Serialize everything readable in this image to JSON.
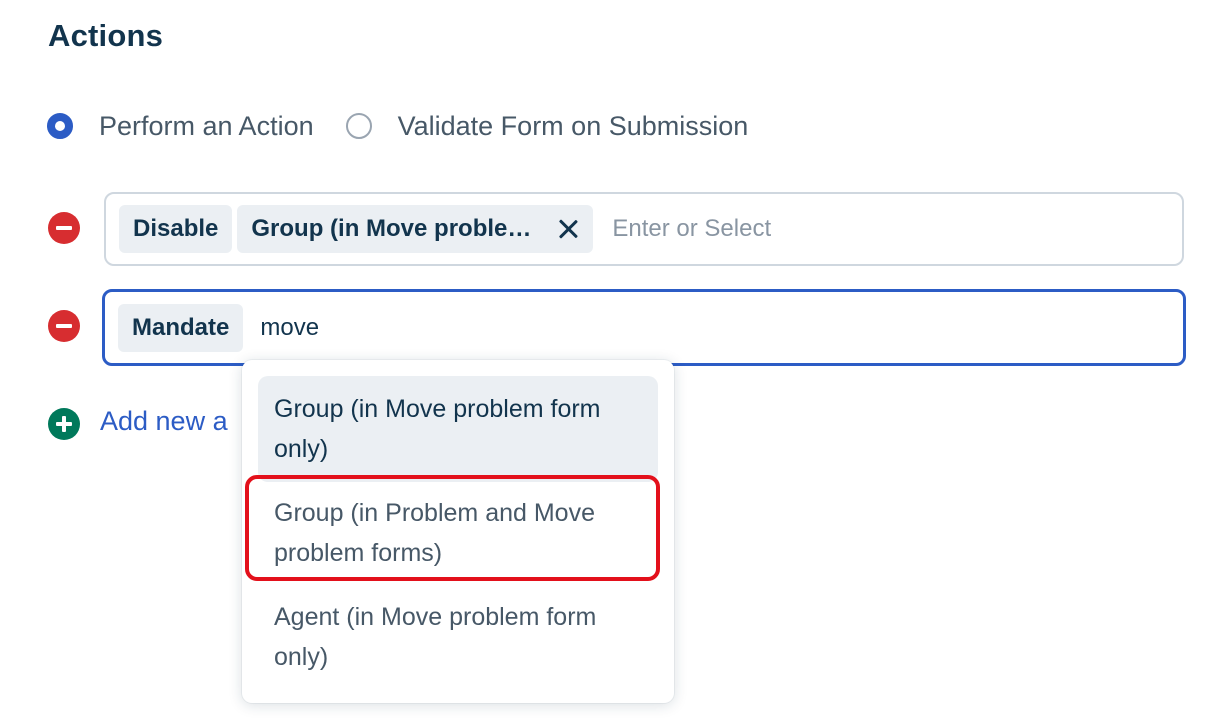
{
  "section": {
    "title": "Actions"
  },
  "action_type": {
    "options": [
      {
        "label": "Perform an Action",
        "selected": true
      },
      {
        "label": "Validate Form on Submission",
        "selected": false
      }
    ]
  },
  "rules": [
    {
      "action": "Disable",
      "target": "Group (in Move proble…",
      "input_value": "",
      "placeholder": "Enter or Select"
    },
    {
      "action": "Mandate",
      "input_value": "move",
      "placeholder": ""
    }
  ],
  "add_action": {
    "label": "Add new a"
  },
  "dropdown": {
    "options": [
      {
        "label": "Group (in Move problem form only)",
        "hovered": true
      },
      {
        "label": "Group (in Problem and Move problem forms)",
        "highlighted": true
      },
      {
        "label": "Agent (in Move problem form only)"
      }
    ]
  },
  "colors": {
    "primary": "#2c5cc5",
    "danger": "#d72d30",
    "success": "#00795b",
    "highlight": "#e3101b",
    "text": "#12344d",
    "muted": "#475867"
  },
  "icons": {
    "remove": "minus-circle-icon",
    "add": "plus-circle-icon",
    "clear_chip": "close-icon"
  }
}
